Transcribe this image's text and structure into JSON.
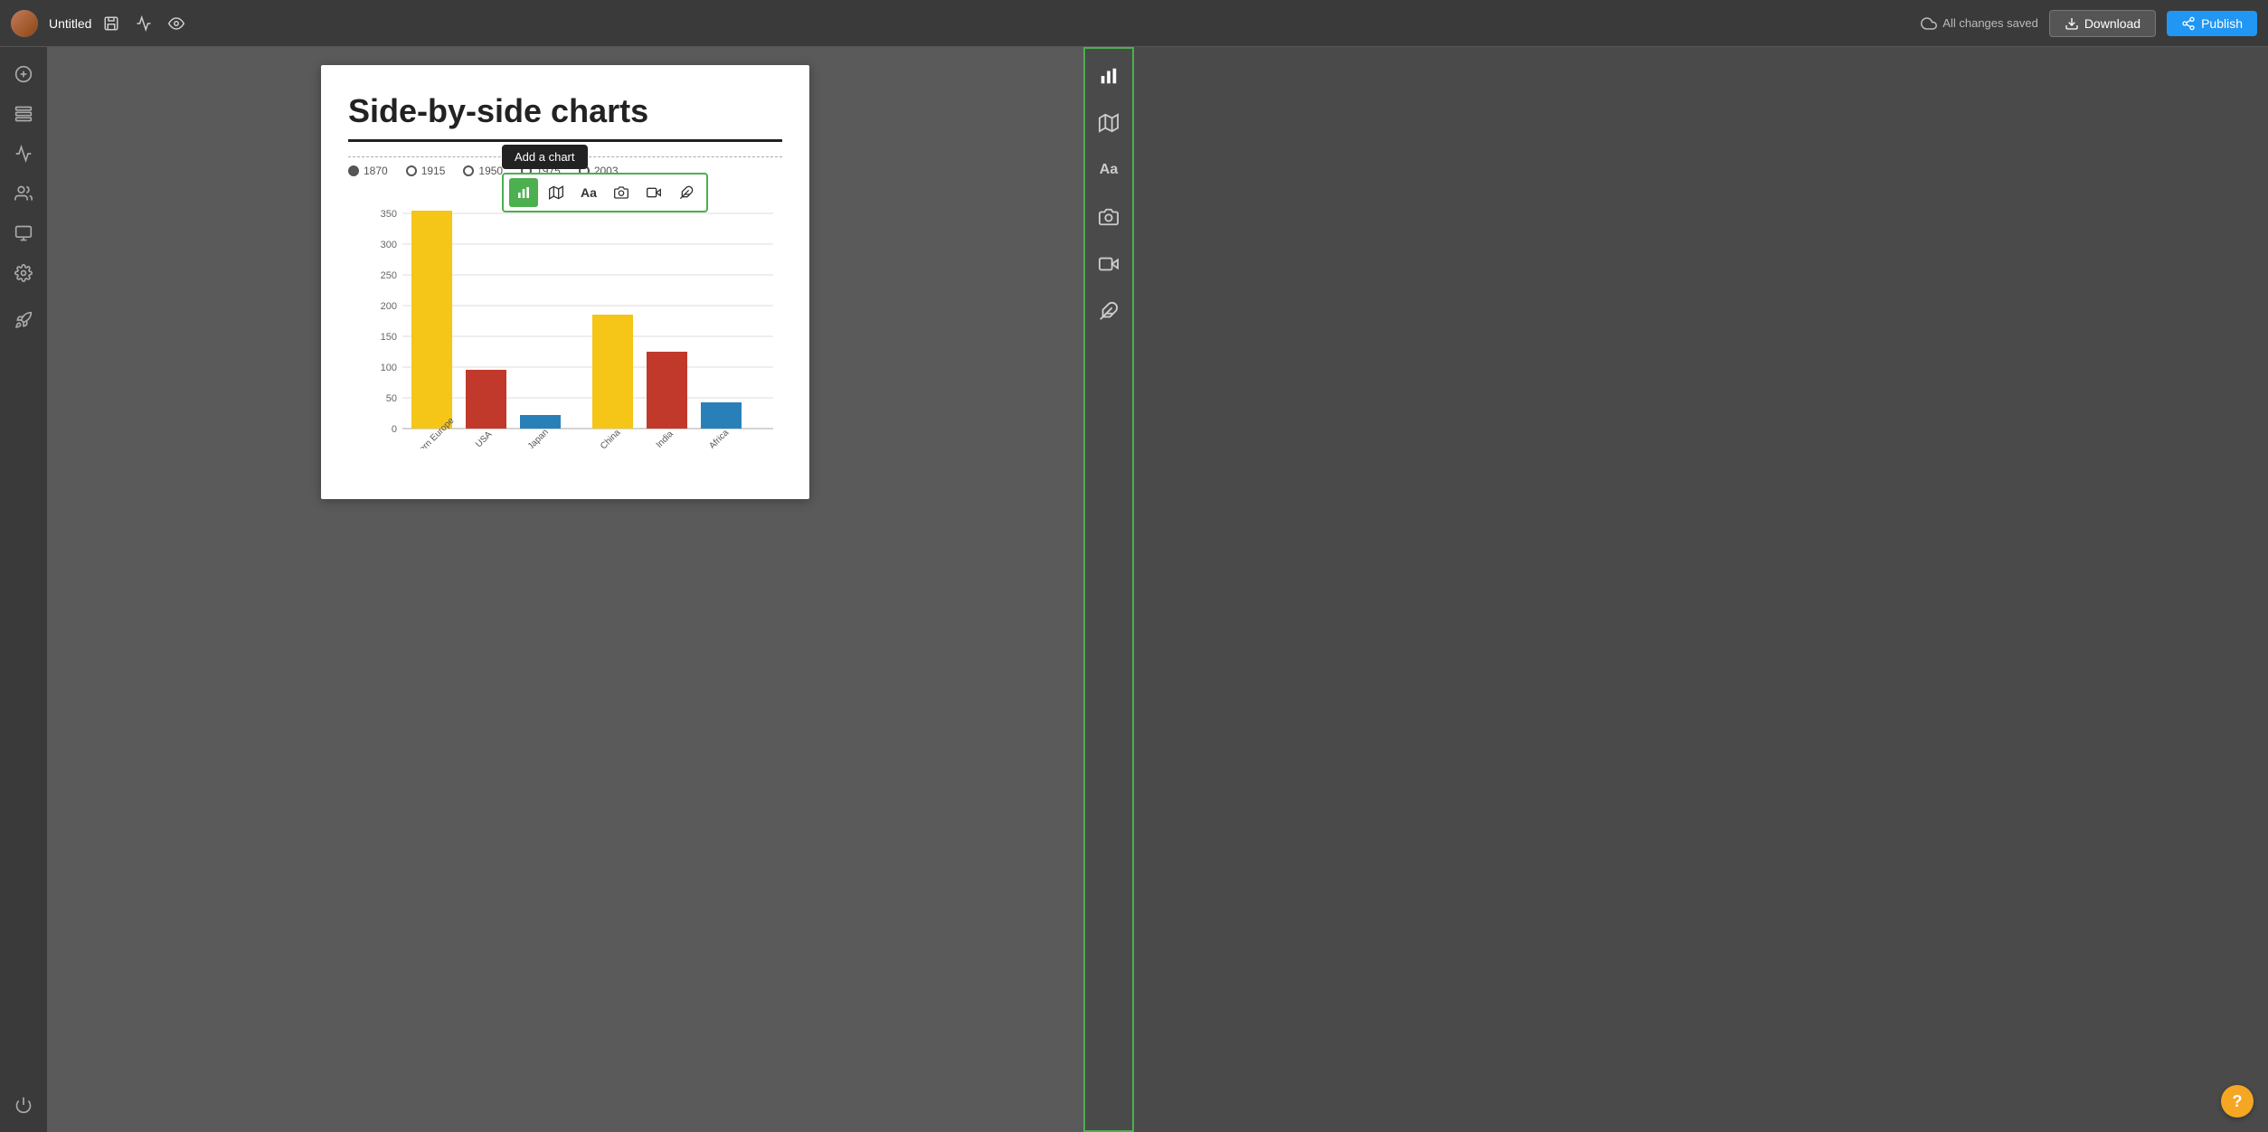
{
  "topbar": {
    "title": "Untitled",
    "save_status": "All changes saved",
    "download_label": "Download",
    "publish_label": "Publish"
  },
  "sidebar": {
    "items": [
      {
        "name": "add-item",
        "icon": "⊕"
      },
      {
        "name": "layers",
        "icon": "▤"
      },
      {
        "name": "chart",
        "icon": "📊"
      },
      {
        "name": "people",
        "icon": "👥"
      },
      {
        "name": "desktop",
        "icon": "🖥"
      },
      {
        "name": "settings",
        "icon": "⚙"
      },
      {
        "name": "rocket",
        "icon": "🚀"
      }
    ],
    "bottom_icon": "⏻"
  },
  "document": {
    "title": "Side-by-side charts",
    "timeline": {
      "years": [
        "1870",
        "1915",
        "1950",
        "1975",
        "2003"
      ]
    }
  },
  "inline_toolbar": {
    "tooltip": "Add a chart",
    "buttons": [
      {
        "name": "chart-btn",
        "icon": "bar",
        "active": true
      },
      {
        "name": "map-btn",
        "icon": "map",
        "active": false
      },
      {
        "name": "text-btn",
        "icon": "Aa",
        "active": false
      },
      {
        "name": "image-btn",
        "icon": "camera",
        "active": false
      },
      {
        "name": "video-btn",
        "icon": "play",
        "active": false
      },
      {
        "name": "plugin-btn",
        "icon": "puzzle",
        "active": false
      }
    ]
  },
  "chart": {
    "y_axis": [
      "350",
      "300",
      "250",
      "200",
      "150",
      "100",
      "50",
      "0"
    ],
    "bars": [
      {
        "label": "Western Europe",
        "value": 355,
        "color": "#f5c518"
      },
      {
        "label": "USA",
        "value": 95,
        "color": "#c0392b"
      },
      {
        "label": "Japan",
        "value": 22,
        "color": "#2980b9"
      },
      {
        "label": "China",
        "value": 185,
        "color": "#f5c518"
      },
      {
        "label": "India",
        "value": 125,
        "color": "#c0392b"
      },
      {
        "label": "Africa",
        "value": 42,
        "color": "#2980b9"
      }
    ],
    "max_value": 360
  },
  "right_panel": {
    "icons": [
      {
        "name": "panel-chart",
        "type": "bar"
      },
      {
        "name": "panel-map",
        "type": "map"
      },
      {
        "name": "panel-text",
        "type": "text"
      },
      {
        "name": "panel-camera",
        "type": "camera"
      },
      {
        "name": "panel-video",
        "type": "video"
      },
      {
        "name": "panel-puzzle",
        "type": "puzzle"
      }
    ]
  },
  "help": {
    "label": "?"
  }
}
